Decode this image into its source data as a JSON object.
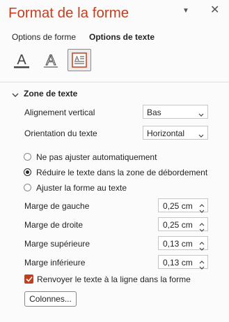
{
  "pane": {
    "title": "Format de la forme",
    "tabs": [
      "Options de forme",
      "Options de texte"
    ],
    "active_tab": "Options de texte",
    "icon_tabs": [
      "text-fill-outline-icon",
      "text-effects-icon",
      "text-box-icon"
    ],
    "selected_icon_tab": "text-box-icon"
  },
  "section": {
    "title": "Zone de texte",
    "expanded": true
  },
  "fields": {
    "vertical_alignment": {
      "label": "Alignement vertical",
      "value": "Bas"
    },
    "text_direction": {
      "label": "Orientation du texte",
      "value": "Horizontal"
    }
  },
  "autofit_options": [
    {
      "label": "Ne pas ajuster automatiquement",
      "selected": false
    },
    {
      "label": "Réduire le texte dans la zone de débordement",
      "selected": true
    },
    {
      "label": "Ajuster la forme au texte",
      "selected": false
    }
  ],
  "margins": [
    {
      "label": "Marge de gauche",
      "value": "0,25 cm"
    },
    {
      "label": "Marge de droite",
      "value": "0,25 cm"
    },
    {
      "label": "Marge supérieure",
      "value": "0,13 cm"
    },
    {
      "label": "Marge inférieure",
      "value": "0,13 cm"
    }
  ],
  "wrap_text": {
    "label": "Renvoyer le texte à la ligne dans la forme",
    "checked": true
  },
  "columns_button": "Colonnes...",
  "colors": {
    "accent": "#c43e1c",
    "text": "#252423",
    "border": "#c8c6c4"
  }
}
